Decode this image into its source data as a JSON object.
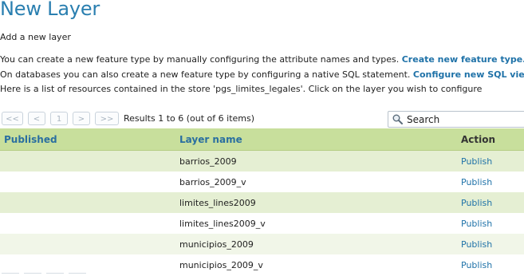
{
  "page": {
    "title": "New Layer",
    "subtitle": "Add a new layer"
  },
  "description": {
    "line1_text": "You can create a new feature type by manually configuring the attribute names and types. ",
    "line1_link": "Create new feature type...",
    "line2_text": "On databases you can also create a new feature type by configuring a native SQL statement. ",
    "line2_link": "Configure new SQL view...",
    "line3_text": "Here is a list of resources contained in the store 'pgs_limites_legales'. Click on the layer you wish to configure"
  },
  "pager": {
    "first": "<<",
    "prev": "<",
    "page": "1",
    "next": ">",
    "last": ">>",
    "info": "Results 1 to 6 (out of 6 items)"
  },
  "search": {
    "placeholder": "Search",
    "value": ""
  },
  "table": {
    "headers": {
      "published": "Published",
      "layer_name": "Layer name",
      "action": "Action"
    },
    "rows": [
      {
        "published": "",
        "layer_name": "barrios_2009",
        "action": "Publish"
      },
      {
        "published": "",
        "layer_name": "barrios_2009_v",
        "action": "Publish"
      },
      {
        "published": "",
        "layer_name": "limites_lines2009",
        "action": "Publish"
      },
      {
        "published": "",
        "layer_name": "limites_lines2009_v",
        "action": "Publish"
      },
      {
        "published": "",
        "layer_name": "municipios_2009",
        "action": "Publish"
      },
      {
        "published": "",
        "layer_name": "municipios_2009_v",
        "action": "Publish"
      }
    ]
  },
  "colors": {
    "title": "#2a7fb0",
    "link": "#1f72a8",
    "header_bg": "#c8df9c",
    "row_alt_bg": "#e5efd3"
  },
  "icons": {
    "search": "magnifier-icon"
  }
}
